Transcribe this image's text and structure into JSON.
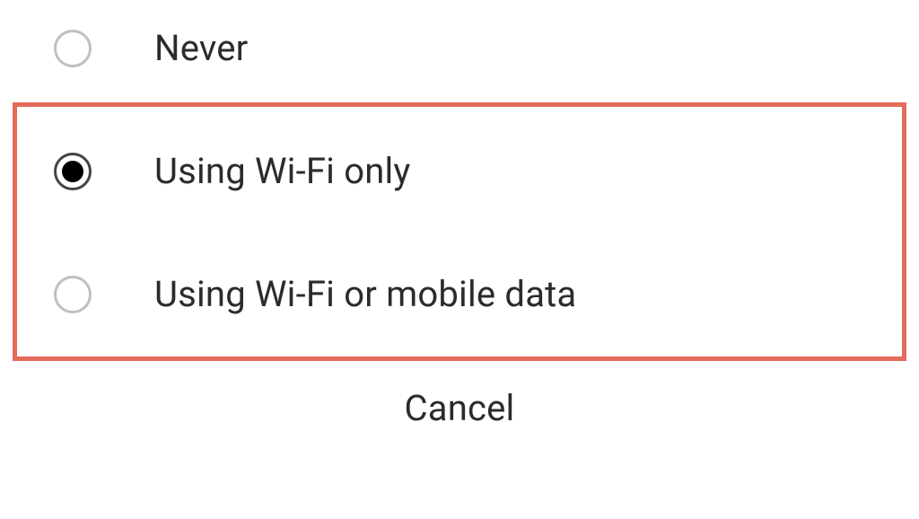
{
  "options": [
    {
      "label": "Never",
      "selected": false
    },
    {
      "label": "Using Wi-Fi only",
      "selected": true
    },
    {
      "label": "Using Wi-Fi or mobile data",
      "selected": false
    }
  ],
  "cancel_label": "Cancel",
  "highlight_color": "#e46a5a"
}
